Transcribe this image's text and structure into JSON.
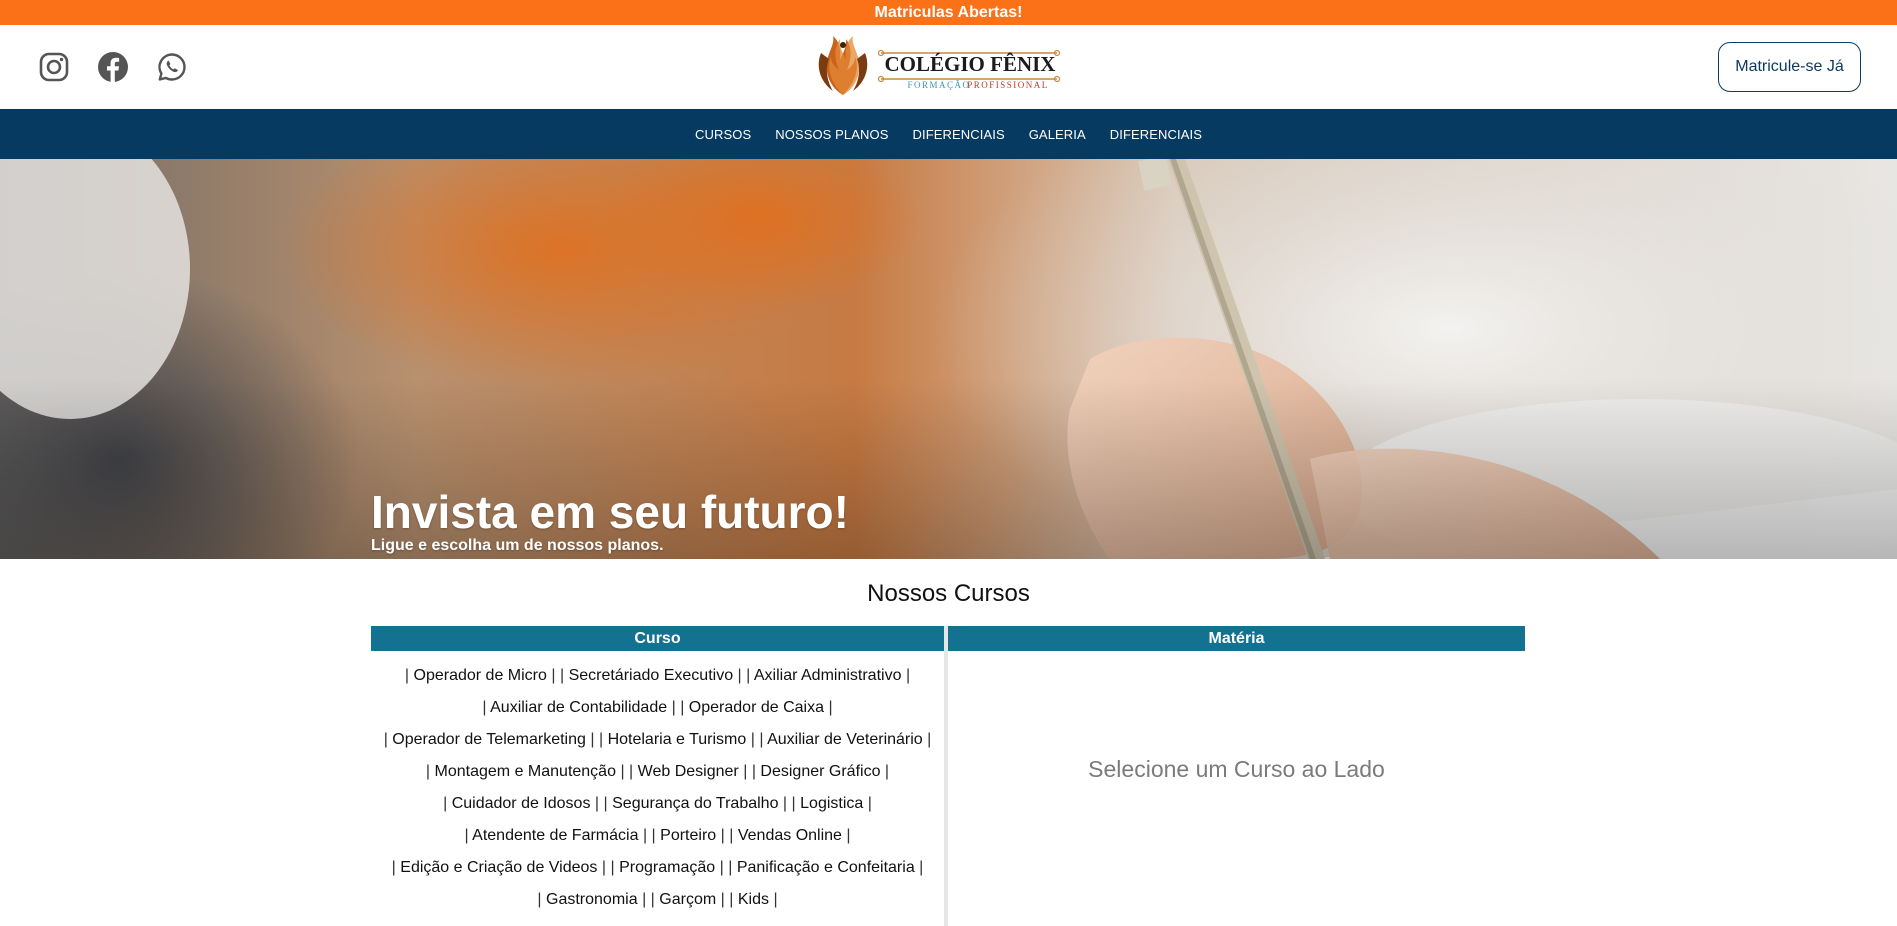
{
  "announcement": "Matriculas Abertas!",
  "header": {
    "social": [
      {
        "icon": "instagram-icon"
      },
      {
        "icon": "facebook-icon"
      },
      {
        "icon": "whatsapp-icon"
      }
    ],
    "logo": {
      "name": "COLÉGIO FÊNIX",
      "tagline_part1": "FORMAÇÃO",
      "tagline_part2": "PROFISSIONAL"
    },
    "cta_label": "Matricule-se Já"
  },
  "nav": [
    "CURSOS",
    "NOSSOS PLANOS",
    "DIFERENCIAIS",
    "GALERIA",
    "DIFERENCIAIS"
  ],
  "hero": {
    "title": "Invista em seu futuro!",
    "subtitle": "Ligue e escolha um de nossos planos."
  },
  "courses_section": {
    "title": "Nossos Cursos",
    "col_course": "Curso",
    "col_subject": "Matéria",
    "rows": [
      [
        "Operador de Micro",
        "Secretáriado Executivo",
        "Axiliar Administrativo"
      ],
      [
        "Auxiliar de Contabilidade",
        "Operador de Caixa"
      ],
      [
        "Operador de Telemarketing",
        "Hotelaria e Turismo",
        "Auxiliar de Veterinário"
      ],
      [
        "Montagem e Manutenção",
        "Web Designer",
        "Designer Gráfico"
      ],
      [
        "Cuidador de Idosos",
        "Segurança do Trabalho",
        "Logistica"
      ],
      [
        "Atendente de Farmácia",
        "Porteiro",
        "Vendas Online"
      ],
      [
        "Edição e Criação de Videos",
        "Programação",
        "Panificação e Confeitaria"
      ],
      [
        "Gastronomia",
        "Garçom",
        "Kids"
      ]
    ],
    "subject_placeholder": "Selecione um Curso ao Lado"
  },
  "colors": {
    "announcement_bg": "#fb7118",
    "nav_bg": "#063a61",
    "table_header_bg": "#137191",
    "cta_border": "#0b3b60"
  }
}
